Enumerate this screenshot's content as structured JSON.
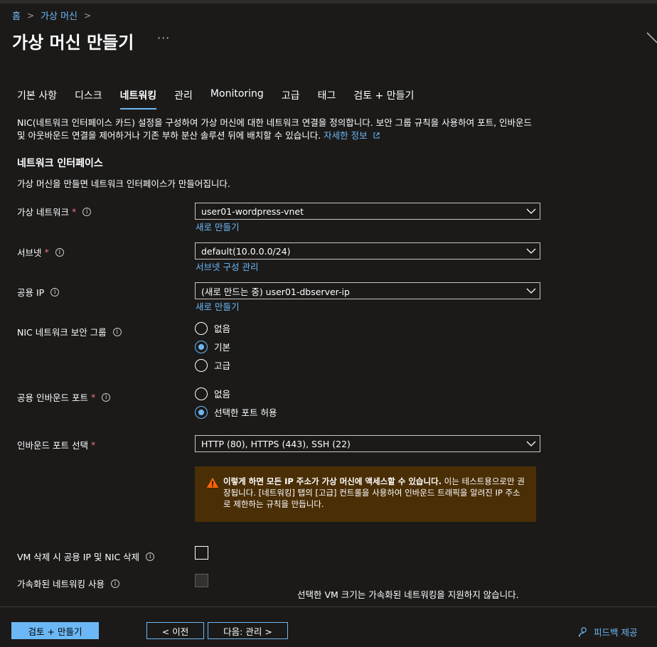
{
  "breadcrumb": {
    "home": "홈",
    "parent": "가상 머신"
  },
  "page": {
    "title": "가상 머신 만들기",
    "more": "···"
  },
  "tabs": [
    "기본 사항",
    "디스크",
    "네트워킹",
    "관리",
    "Monitoring",
    "고급",
    "태그",
    "검토 + 만들기"
  ],
  "active_tab": "네트워킹",
  "description": {
    "text": "NIC(네트워크 인터페이스 카드) 설정을 구성하여 가상 머신에 대한 네트워크 연결을 정의합니다. 보안 그룹 규칙을 사용하여 포트, 인바운드 및 아웃바운드 연결을 제어하거나 기존 부하 분산 솔루션 뒤에 배치할 수 있습니다.",
    "link": "자세한 정보"
  },
  "section": {
    "title": "네트워크 인터페이스",
    "subtitle": "가상 머신을 만들면 네트워크 인터페이스가 만들어집니다."
  },
  "fields": {
    "vnet": {
      "label": "가상 네트워크",
      "required": "*",
      "value": "user01-wordpress-vnet",
      "link": "새로 만들기"
    },
    "subnet": {
      "label": "서브넷",
      "required": "*",
      "value": "default(10.0.0.0/24)",
      "link": "서브넷 구성 관리"
    },
    "public_ip": {
      "label": "공용 IP",
      "value": "(새로 만드는 중) user01-dbserver-ip",
      "link": "새로 만들기"
    },
    "nsg": {
      "label": "NIC 네트워크 보안 그룹",
      "options": [
        "없음",
        "기본",
        "고급"
      ],
      "selected": "기본"
    },
    "inbound_ports": {
      "label": "공용 인바운드 포트",
      "required": "*",
      "options": [
        "없음",
        "선택한 포트 허용"
      ],
      "selected": "선택한 포트 허용"
    },
    "select_ports": {
      "label": "인바운드 포트 선택",
      "required": "*",
      "value": "HTTP (80), HTTPS (443), SSH (22)"
    },
    "delete_ip_nic": {
      "label": "VM 삭제 시 공용 IP 및 NIC 삭제",
      "checked": false
    },
    "accel_net": {
      "label": "가속화된 네트워킹 사용",
      "checked": false,
      "disabled": true,
      "note": "선택한 VM 크기는 가속화된 네트워킹을 지원하지 않습니다."
    }
  },
  "warning": {
    "bold": "이렇게 하면 모든 IP 주소가 가상 머신에 액세스할 수 있습니다.",
    "text": " 이는 테스트용으로만 권장됩니다. [네트워킹] 탭의 [고급] 컨트롤을 사용하여 인바운드 트래픽을 알려진 IP 주소로 제한하는 규칙을 만듭니다."
  },
  "footer": {
    "review_create": "검토 + 만들기",
    "previous": "< 이전",
    "next": "다음: 관리 >",
    "feedback": "피드백 제공"
  },
  "colors": {
    "accent": "#6cb8f6",
    "background": "#1b1a19",
    "warning_bg": "#4a2e05",
    "required": "#f1707b"
  }
}
